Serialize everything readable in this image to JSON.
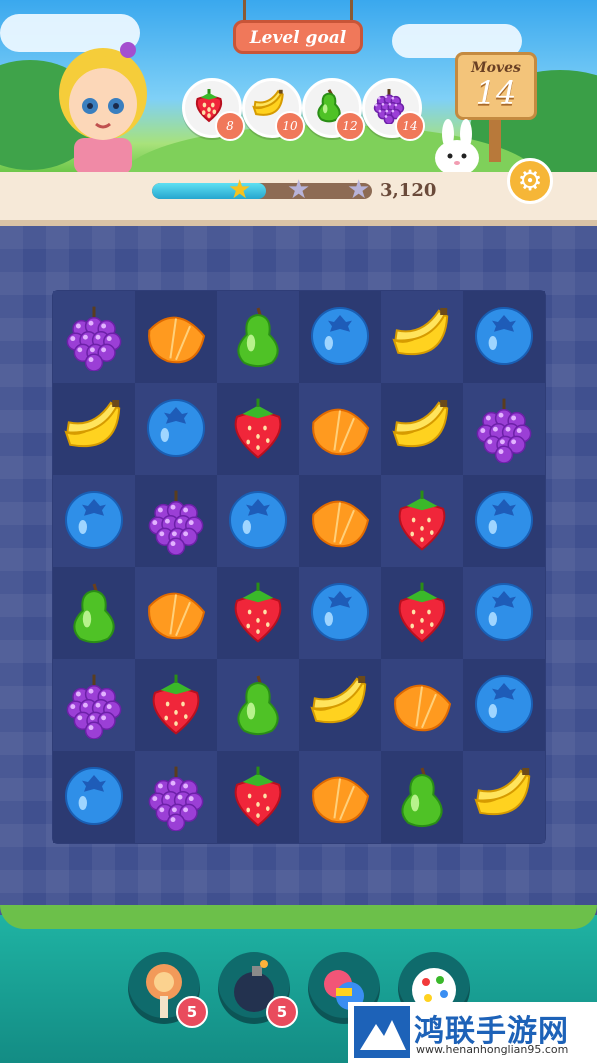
{
  "header": {
    "goal_title": "Level goal",
    "moves_label": "Moves",
    "moves_value": "14",
    "score": "3,120",
    "progress_fraction": 0.52,
    "stars_earned": 1,
    "stars_total": 3
  },
  "goals": [
    {
      "fruit": "strawberry",
      "count": "8"
    },
    {
      "fruit": "banana",
      "count": "10"
    },
    {
      "fruit": "pear",
      "count": "12"
    },
    {
      "fruit": "grape",
      "count": "14"
    }
  ],
  "board": {
    "rows": 6,
    "cols": 6,
    "cells": [
      [
        "grape",
        "orange",
        "pear",
        "blueberry",
        "banana",
        "blueberry"
      ],
      [
        "banana",
        "blueberry",
        "strawberry",
        "orange",
        "banana",
        "grape"
      ],
      [
        "blueberry",
        "grape",
        "blueberry",
        "orange",
        "strawberry",
        "blueberry"
      ],
      [
        "pear",
        "orange",
        "strawberry",
        "blueberry",
        "strawberry",
        "blueberry"
      ],
      [
        "grape",
        "strawberry",
        "pear",
        "banana",
        "orange",
        "blueberry"
      ],
      [
        "blueberry",
        "grape",
        "strawberry",
        "orange",
        "pear",
        "banana"
      ]
    ]
  },
  "boosters": [
    {
      "name": "lollipop-hammer",
      "count": "5"
    },
    {
      "name": "bomb",
      "count": "5"
    },
    {
      "name": "candy-swap",
      "count": ""
    },
    {
      "name": "color-ball",
      "count": ""
    }
  ],
  "watermark": {
    "title": "鸿联手游网",
    "url": "www.henanhonglian95.com"
  },
  "colors": {
    "board": "#40508f",
    "grid": "#2f3d77",
    "progress": "#26a6cf",
    "sign": "#f0785a"
  }
}
